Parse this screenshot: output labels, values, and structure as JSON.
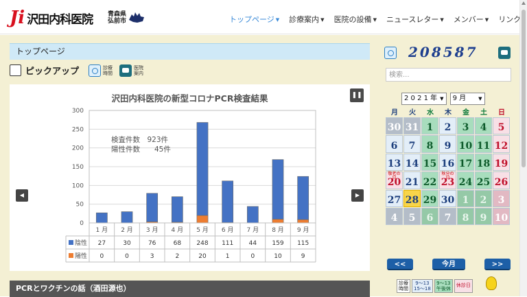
{
  "header": {
    "logo_mark": "Ji",
    "logo_text": "沢田内科医院",
    "location_line1": "青森県",
    "location_line2": "弘前市",
    "nav": [
      {
        "label": "トップページ",
        "active": true
      },
      {
        "label": "診療案内"
      },
      {
        "label": "医院の設備"
      },
      {
        "label": "ニュースレター"
      },
      {
        "label": "メンバー"
      },
      {
        "label": "リンク集"
      }
    ]
  },
  "main": {
    "page_title": "トップページ",
    "pickup_label": "ピックアップ",
    "hours_label_1": "診療",
    "hours_label_2": "時間",
    "guide_label_1": "医院",
    "guide_label_2": "案内",
    "section_title": "PCRとワクチンの話（酒田源也）"
  },
  "chart_data": {
    "type": "bar",
    "title": "沢田内科医院の新型コロナPCR検査結果",
    "categories": [
      "1 月",
      "2 月",
      "3 月",
      "4 月",
      "5 月",
      "6 月",
      "7 月",
      "8 月",
      "9 月"
    ],
    "series": [
      {
        "name": "陰性",
        "values": [
          27,
          30,
          76,
          68,
          248,
          111,
          44,
          159,
          115
        ],
        "color": "#4472c4"
      },
      {
        "name": "陽性",
        "values": [
          0,
          0,
          3,
          2,
          20,
          1,
          0,
          10,
          9
        ],
        "color": "#ed7d31"
      }
    ],
    "stacked": true,
    "ylim": [
      0,
      300
    ],
    "yticks": [
      0,
      50,
      100,
      150,
      200,
      250,
      300
    ],
    "annotation_line1": "検査件数　923件",
    "annotation_line2": "陽性件数　　45件",
    "data_table": true
  },
  "sidebar": {
    "counter": "208587",
    "search_placeholder": "検索...",
    "year_select": "2 0 2 1 年",
    "month_select": "9 月",
    "weekdays": [
      "月",
      "火",
      "水",
      "木",
      "金",
      "土",
      "日"
    ],
    "weekday_colors": [
      "#1d3f7d",
      "#1d3f7d",
      "#0c7a3a",
      "#1d3f7d",
      "#0c7a3a",
      "#0c7a3a",
      "#c0102b"
    ],
    "days": [
      {
        "d": "30",
        "t": "out"
      },
      {
        "d": "31",
        "t": "out"
      },
      {
        "d": "1",
        "t": "grn"
      },
      {
        "d": "2",
        "t": "thu"
      },
      {
        "d": "3",
        "t": "grn"
      },
      {
        "d": "4",
        "t": "sat"
      },
      {
        "d": "5",
        "t": "sun"
      },
      {
        "d": "6",
        "t": "norm"
      },
      {
        "d": "7",
        "t": "norm"
      },
      {
        "d": "8",
        "t": "grn"
      },
      {
        "d": "9",
        "t": "thu"
      },
      {
        "d": "10",
        "t": "grn"
      },
      {
        "d": "11",
        "t": "sat"
      },
      {
        "d": "12",
        "t": "sun"
      },
      {
        "d": "13",
        "t": "norm"
      },
      {
        "d": "14",
        "t": "norm"
      },
      {
        "d": "15",
        "t": "grn"
      },
      {
        "d": "16",
        "t": "thu"
      },
      {
        "d": "17",
        "t": "grn"
      },
      {
        "d": "18",
        "t": "sat"
      },
      {
        "d": "19",
        "t": "sun"
      },
      {
        "d": "20",
        "t": "hol",
        "note": "敬老の日"
      },
      {
        "d": "21",
        "t": "norm"
      },
      {
        "d": "22",
        "t": "grn"
      },
      {
        "d": "23",
        "t": "hol",
        "note": "秋分の日"
      },
      {
        "d": "24",
        "t": "grn"
      },
      {
        "d": "25",
        "t": "sat"
      },
      {
        "d": "26",
        "t": "sun"
      },
      {
        "d": "27",
        "t": "norm"
      },
      {
        "d": "28",
        "t": "today"
      },
      {
        "d": "29",
        "t": "grn"
      },
      {
        "d": "30",
        "t": "thu"
      },
      {
        "d": "1",
        "t": "outg"
      },
      {
        "d": "2",
        "t": "outg"
      },
      {
        "d": "3",
        "t": "outp"
      },
      {
        "d": "4",
        "t": "out"
      },
      {
        "d": "5",
        "t": "out"
      },
      {
        "d": "6",
        "t": "outg"
      },
      {
        "d": "7",
        "t": "out"
      },
      {
        "d": "8",
        "t": "outg"
      },
      {
        "d": "9",
        "t": "outg"
      },
      {
        "d": "10",
        "t": "outp"
      }
    ],
    "prev_label": "<<",
    "today_label": "今月",
    "next_label": ">>",
    "legend": {
      "hours_1": "診療",
      "hours_2": "時間",
      "b_1": "9〜13",
      "b_2": "15〜18",
      "g_1": "9〜13",
      "g_2": "午後休",
      "p_1": "休診日"
    }
  }
}
